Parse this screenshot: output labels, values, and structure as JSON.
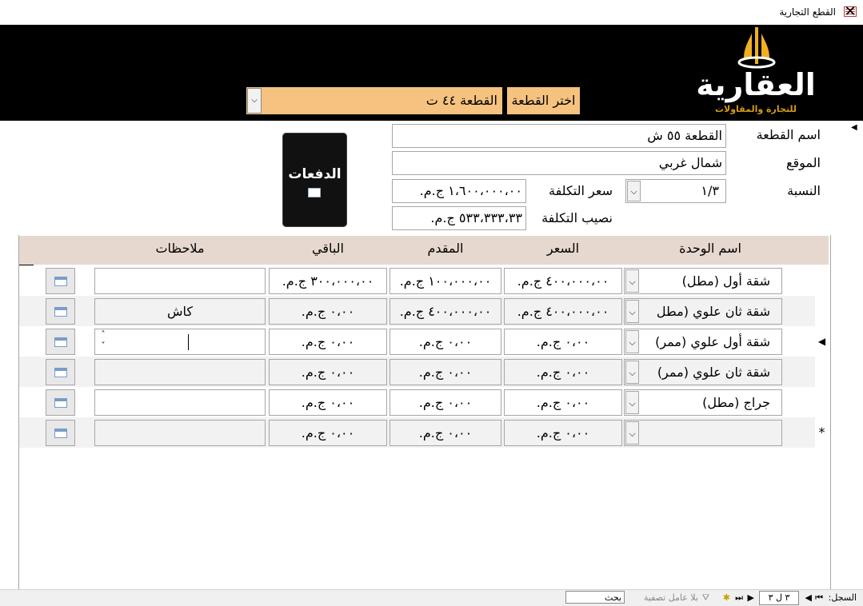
{
  "window": {
    "title": "القطع التجارية",
    "close_glyph": "✕"
  },
  "header": {
    "logo_text": "العقارية",
    "logo_subtitle": "للتجارة والمقاولات",
    "choose_label": "اختر القطعة",
    "choose_value": "القطعة ٤٤ ت"
  },
  "form": {
    "plot_name_label": "اسم القطعة",
    "plot_name": "القطعة ٥٥ ش",
    "location_label": "الموقع",
    "location": "شمال غربي",
    "ratio_label": "النسبة",
    "ratio": "١/٣",
    "cost_price_label": "سعر التكلفة",
    "cost_price": "١،٦٠٠،٠٠٠،٠٠ ج.م.",
    "cost_share_label": "نصيب التكلفة",
    "cost_share": "٥٣٣،٣٣٣،٣٣ ج.م.",
    "payments_button": "الدفعات"
  },
  "subform": {
    "columns": {
      "unit": "اسم الوحدة",
      "price": "السعر",
      "down": "المقدم",
      "rest": "الباقي",
      "notes": "ملاحظات"
    },
    "rows": [
      {
        "unit": "شقة أول (مطل)",
        "price": "٤٠٠،٠٠٠،٠٠ ج.م.",
        "down": "١٠٠،٠٠٠،٠٠ ج.م.",
        "rest": "٣٠٠،٠٠٠،٠٠ ج.م.",
        "notes": ""
      },
      {
        "unit": "شقة ثان علوي (مطل",
        "price": "٤٠٠،٠٠٠،٠٠ ج.م.",
        "down": "٤٠٠،٠٠٠،٠٠ ج.م.",
        "rest": "٠،٠٠ ج.م.",
        "notes": "كاش"
      },
      {
        "unit": "شقة أول علوي (ممر)",
        "price": "٠،٠٠ ج.م.",
        "down": "٠،٠٠ ج.م.",
        "rest": "٠،٠٠ ج.م.",
        "notes": ""
      },
      {
        "unit": "شقة ثان علوي (ممر)",
        "price": "٠،٠٠ ج.م.",
        "down": "٠،٠٠ ج.م.",
        "rest": "٠،٠٠ ج.م.",
        "notes": ""
      },
      {
        "unit": "جراج (مطل)",
        "price": "٠،٠٠ ج.م.",
        "down": "٠،٠٠ ج.م.",
        "rest": "٠،٠٠ ج.م.",
        "notes": ""
      },
      {
        "unit": "",
        "price": "٠،٠٠ ج.م.",
        "down": "٠،٠٠ ج.م.",
        "rest": "٠،٠٠ ج.م.",
        "notes": ""
      }
    ],
    "current_row_marker": "◀",
    "new_row_marker": "*"
  },
  "statusbar": {
    "record_label": "السجل:",
    "record_value": "٣ ل ٣",
    "filter_label": "بلا عامل تصفية",
    "search_placeholder": "بحث"
  }
}
